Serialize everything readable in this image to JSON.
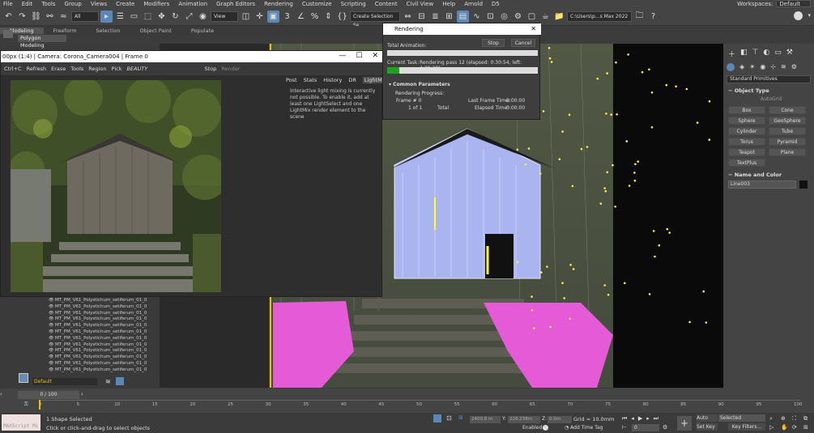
{
  "menu": [
    "File",
    "Edit",
    "Tools",
    "Group",
    "Views",
    "Create",
    "Modifiers",
    "Animation",
    "Graph Editors",
    "Rendering",
    "Customize",
    "Scripting",
    "Content",
    "Civil View",
    "Help",
    "Arnold",
    "D5"
  ],
  "workspaces": {
    "label": "Workspaces:",
    "value": "Default"
  },
  "toolbar": {
    "filter": "All",
    "ref_coord": "View",
    "selection_set": "Create Selection Se",
    "path": "C:\\Users\\p...s Max 2022"
  },
  "ribbon": {
    "tabs": [
      "Modeling",
      "Freeform",
      "Selection",
      "Object Paint",
      "Populate"
    ],
    "sub": "Polygon Modeling"
  },
  "frame_buffer": {
    "title": "00px (1:4) | Camera: Corona_Camera004 | Frame 0",
    "tools": [
      "Ctrl+C",
      "Refresh",
      "Erase",
      "Tools",
      "Region",
      "Pick",
      "BEAUTY",
      "Stop",
      "Render"
    ],
    "tabs": [
      "Post",
      "Stats",
      "History",
      "DR",
      "LightMix"
    ],
    "message": "Interactive light mixing is currently not possible. To enable it, add at least one LightSelect and one LightMix render element to the scene"
  },
  "render_dialog": {
    "title": "Rendering",
    "stop": "Stop",
    "cancel": "Cancel",
    "total_animation": "Total Animation:",
    "current_task_label": "Current Task:",
    "current_task": "Rendering pass 12 (elapsed: 0:30:54, left: 4:29:28)",
    "progress": 0.08,
    "section": "Common Parameters",
    "rendering_progress": "Rendering Progress:",
    "frame_label": "Frame #",
    "frame_value": "0",
    "of_label": "1 of 1",
    "total": "Total",
    "last_frame_time": "Last Frame Time:",
    "last_frame_value": "0:00:00",
    "elapsed_time": "Elapsed Time:",
    "elapsed_value": "0:00:00"
  },
  "command_panel": {
    "dropdown": "Standard Primitives",
    "object_type": "Object Type",
    "autogrid": "AutoGrid",
    "buttons": [
      "Box",
      "Cone",
      "Sphere",
      "GeoSphere",
      "Cylinder",
      "Tube",
      "Torus",
      "Pyramid",
      "Teapot",
      "Plane",
      "TextPlus"
    ],
    "name_color": "Name and Color",
    "object_name": "Line003"
  },
  "explorer": {
    "rows": [
      "MT_PM_V61_Polystichum_setiferum_01_0",
      "MT_PM_V61_Polystichum_setiferum_01_0",
      "MT_PM_V61_Polystichum_setiferum_01_0",
      "MT_PM_V61_Polystichum_setiferum_01_0",
      "MT_PM_V61_Polystichum_setiferum_01_0",
      "MT_PM_V61_Polystichum_setiferum_01_0",
      "MT_PM_V61_Polystichum_setiferum_01_0",
      "MT_PM_V61_Polystichum_setiferum_01_0",
      "MT_PM_V61_Polystichum_setiferum_01_0",
      "MT_PM_V61_Polystichum_setiferum_01_0",
      "MT_PM_V61_Polystichum_setiferum_01_0",
      "MT_PM_V61_Polystichum_setiferum_01_0"
    ],
    "layer": "Default"
  },
  "timeline": {
    "slider": "0 / 100",
    "ticks": [
      "0",
      "5",
      "10",
      "15",
      "20",
      "25",
      "30",
      "35",
      "40",
      "45",
      "50",
      "55",
      "60",
      "65",
      "70",
      "75",
      "80",
      "85",
      "90",
      "95",
      "100"
    ]
  },
  "status": {
    "maxscript": "MAXScript Mi",
    "selected": "1 Shape Selected",
    "prompt": "Click or click-and-drag to select objects",
    "x": "2400.8 m",
    "y_label": "Y:",
    "y": "228.238m",
    "z_label": "Z:",
    "z": "0.0m",
    "grid": "Grid = 10.0mm",
    "enabled": "Enabled:",
    "add_time_tag": "Add Time Tag",
    "auto_key": "Auto Key",
    "set_key": "Set Key",
    "key_selected": "Selected",
    "key_filters": "Key Filters...",
    "frame": "0"
  }
}
